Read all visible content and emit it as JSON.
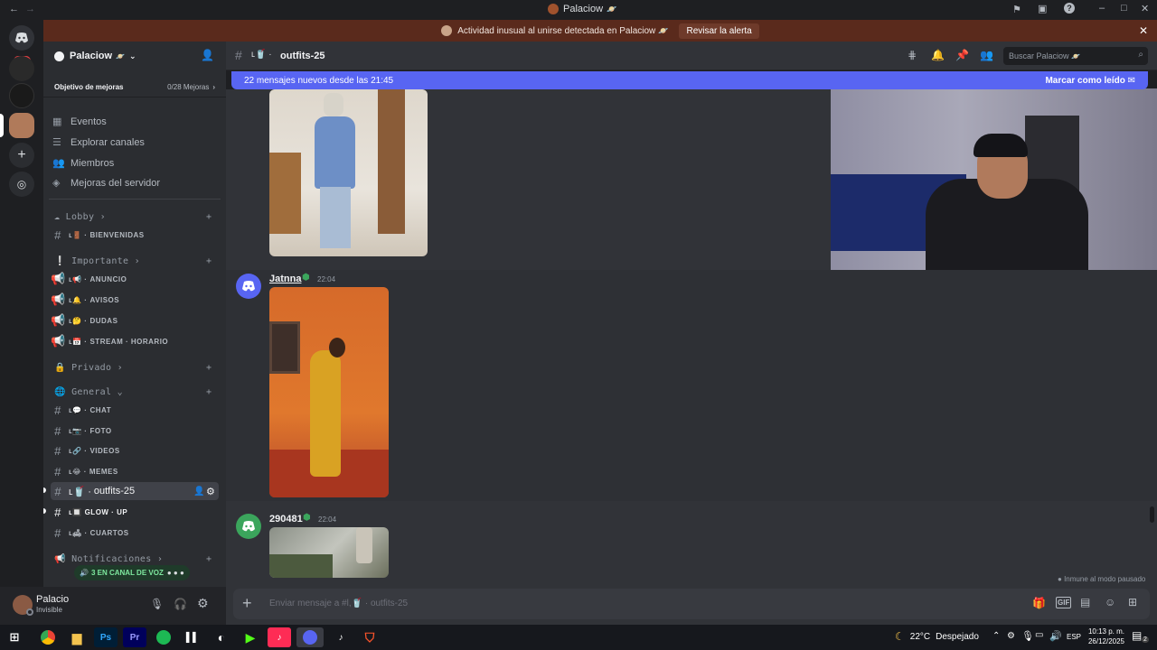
{
  "window": {
    "title": "Palaciow",
    "title_emoji": "🪐"
  },
  "alert": {
    "text": "Actividad inusual al unirse detectada en Palaciow",
    "emoji": "🪐",
    "button_label": "Revisar la alerta"
  },
  "rail": {
    "badge_count": "153"
  },
  "server": {
    "name": "Palaciow",
    "name_emoji": "🪐",
    "boost_goal_label": "Objetivo de mejoras",
    "boost_goal_value": "0/28 Mejoras"
  },
  "menu": {
    "items": [
      {
        "label": "Eventos",
        "icon": "calendar-icon"
      },
      {
        "label": "Explorar canales",
        "icon": "list-icon"
      },
      {
        "label": "Miembros",
        "icon": "members-icon"
      },
      {
        "label": "Mejoras del servidor",
        "icon": "boost-icon"
      }
    ]
  },
  "categories": {
    "lobby": "Lobby",
    "importante": "Importante",
    "privado": "Privado",
    "general": "General",
    "notificaciones": "Notificaciones"
  },
  "channels": {
    "bienvenidas": "BIENVENIDAS",
    "anuncio": "ANUNCIO",
    "avisos": "AVISOS",
    "dudas": "DUDAS",
    "stream": "STREAM · HORARIO",
    "chat": "CHAT",
    "foto": "FOTO",
    "videos": "VIDEOS",
    "memes": "MEMES",
    "outfits": "outfits-25",
    "glow": "GLOW · UP",
    "cuartos": "CUARTOS"
  },
  "voice": {
    "label": "3 EN CANAL DE VOZ"
  },
  "user": {
    "name": "Palacio",
    "status": "Invisible"
  },
  "header": {
    "channel": "outfits-25",
    "search_placeholder": "Buscar Palaciow"
  },
  "newbar": {
    "text": "22 mensajes nuevos desde las 21:45",
    "mark_read": "Marcar como leído"
  },
  "messages": [
    {
      "author": "Jatnna",
      "time": "22:04"
    },
    {
      "author": "290481",
      "time": "22:04"
    }
  ],
  "chat_footer": {
    "immune": "Inmune al modo pausado"
  },
  "composer": {
    "placeholder": "Enviar mensaje a #l,🥤 · outfits-25"
  },
  "taskbar": {
    "weather_temp": "22°C",
    "weather_text": "Despejado",
    "lang": "ESP",
    "time": "10:13 p. m.",
    "date": "26/12/2025",
    "notif_count": "2"
  }
}
